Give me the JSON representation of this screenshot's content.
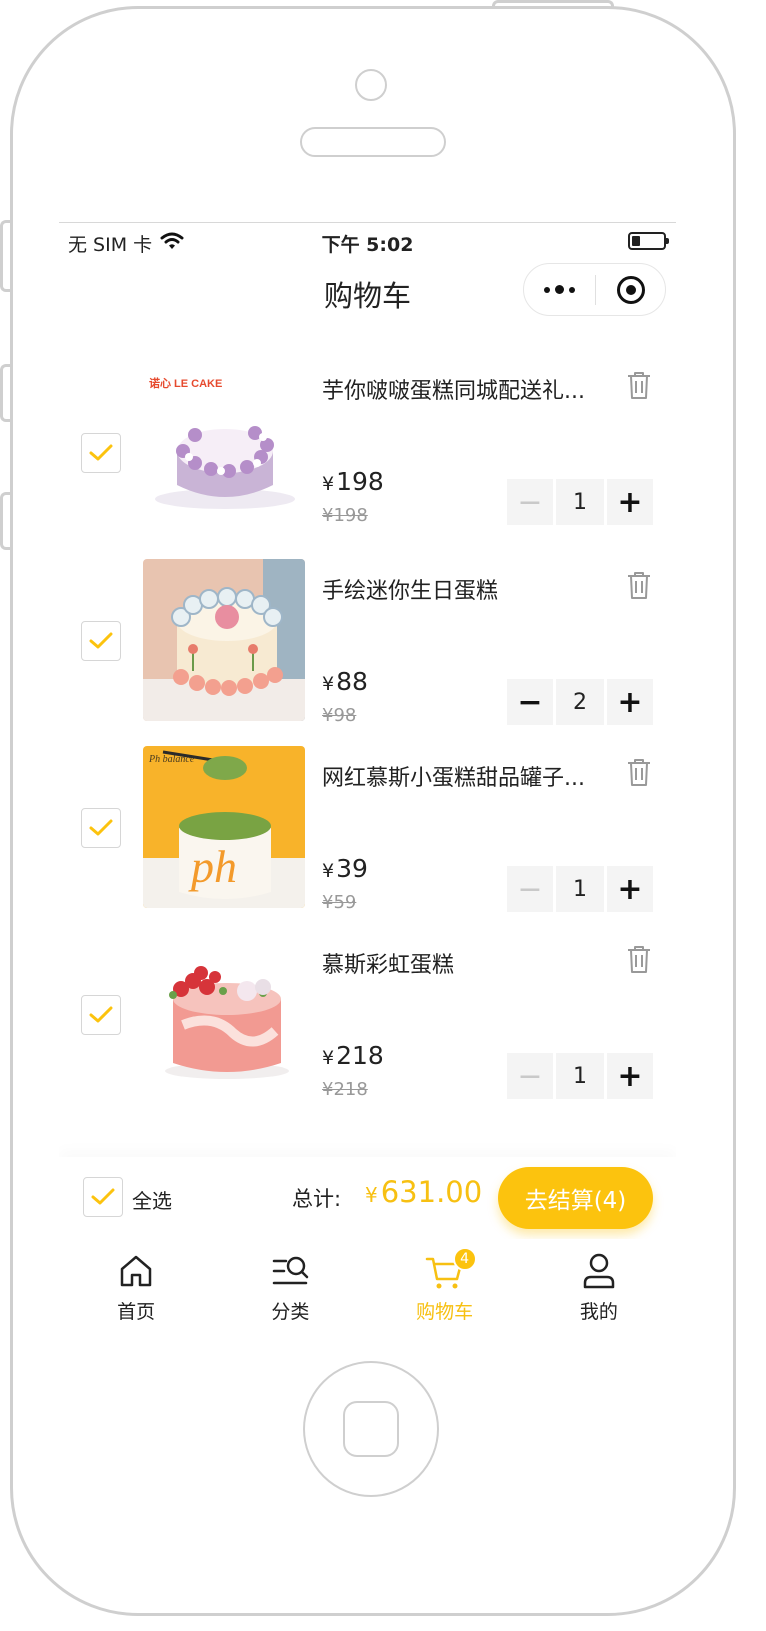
{
  "status_bar": {
    "carrier": "无 SIM 卡",
    "time": "下午 5:02"
  },
  "nav": {
    "title": "购物车"
  },
  "items": [
    {
      "title": "芋你啵啵蛋糕同城配送礼...",
      "price": "198",
      "original_price": "¥198",
      "quantity": "1",
      "checked": true,
      "brand_text": "诺心 LE CAKE"
    },
    {
      "title": "手绘迷你生日蛋糕",
      "price": "88",
      "original_price": "¥98",
      "quantity": "2",
      "checked": true
    },
    {
      "title": "网红慕斯小蛋糕甜品罐子...",
      "price": "39",
      "original_price": "¥59",
      "quantity": "1",
      "checked": true,
      "brand_text": "Ph balance"
    },
    {
      "title": "慕斯彩虹蛋糕",
      "price": "218",
      "original_price": "¥218",
      "quantity": "1",
      "checked": true
    }
  ],
  "currency_symbol": "¥",
  "footer": {
    "select_all_label": "全选",
    "total_label": "总计:",
    "total_value": "631.00",
    "checkout_label": "去结算(4)"
  },
  "tabs": [
    {
      "label": "首页",
      "icon": "home-icon"
    },
    {
      "label": "分类",
      "icon": "category-search-icon"
    },
    {
      "label": "购物车",
      "icon": "cart-icon",
      "active": true,
      "badge": "4"
    },
    {
      "label": "我的",
      "icon": "user-icon"
    }
  ],
  "colors": {
    "accent": "#fcc30e",
    "accent_text": "#f7c012"
  }
}
